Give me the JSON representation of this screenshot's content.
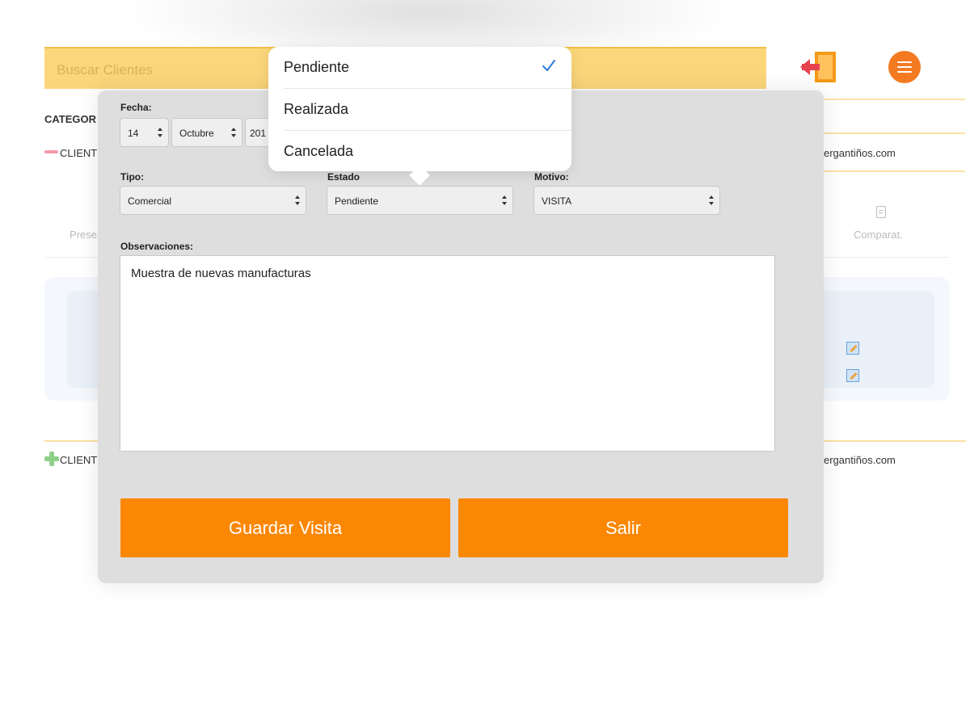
{
  "search": {
    "placeholder": "Buscar Clientes"
  },
  "background": {
    "categoria_label": "CATEGOR",
    "cliente_row_1": "CLIENT",
    "cliente_row_2": "CLIENT",
    "email_1": "ergantiños.com",
    "email_2": "ergantiños.com",
    "tab_left": "Prese",
    "tab_right": "Comparat."
  },
  "modal": {
    "fecha": {
      "label": "Fecha:",
      "day": "14",
      "month": "Octubre",
      "year": "201"
    },
    "tipo": {
      "label": "Tipo:",
      "value": "Comercial"
    },
    "estado": {
      "label": "Estado",
      "value": "Pendiente"
    },
    "motivo": {
      "label": "Motivo:",
      "value": "VISITA"
    },
    "observaciones": {
      "label": "Observaciones:",
      "value": "Muestra de nuevas manufacturas"
    },
    "buttons": {
      "save": "Guardar Visita",
      "exit": "Salir"
    }
  },
  "estado_popover": {
    "options": [
      "Pendiente",
      "Realizada",
      "Cancelada"
    ],
    "selected": "Pendiente"
  },
  "colors": {
    "accent": "#fb8703",
    "search_bg": "#fbd67a",
    "menu_button": "#f47a21",
    "check": "#2b7be0"
  },
  "icons": [
    "exit-door-icon",
    "hamburger-menu-icon",
    "check-icon",
    "document-icon",
    "edit-icon",
    "plus-icon",
    "minus-icon"
  ]
}
